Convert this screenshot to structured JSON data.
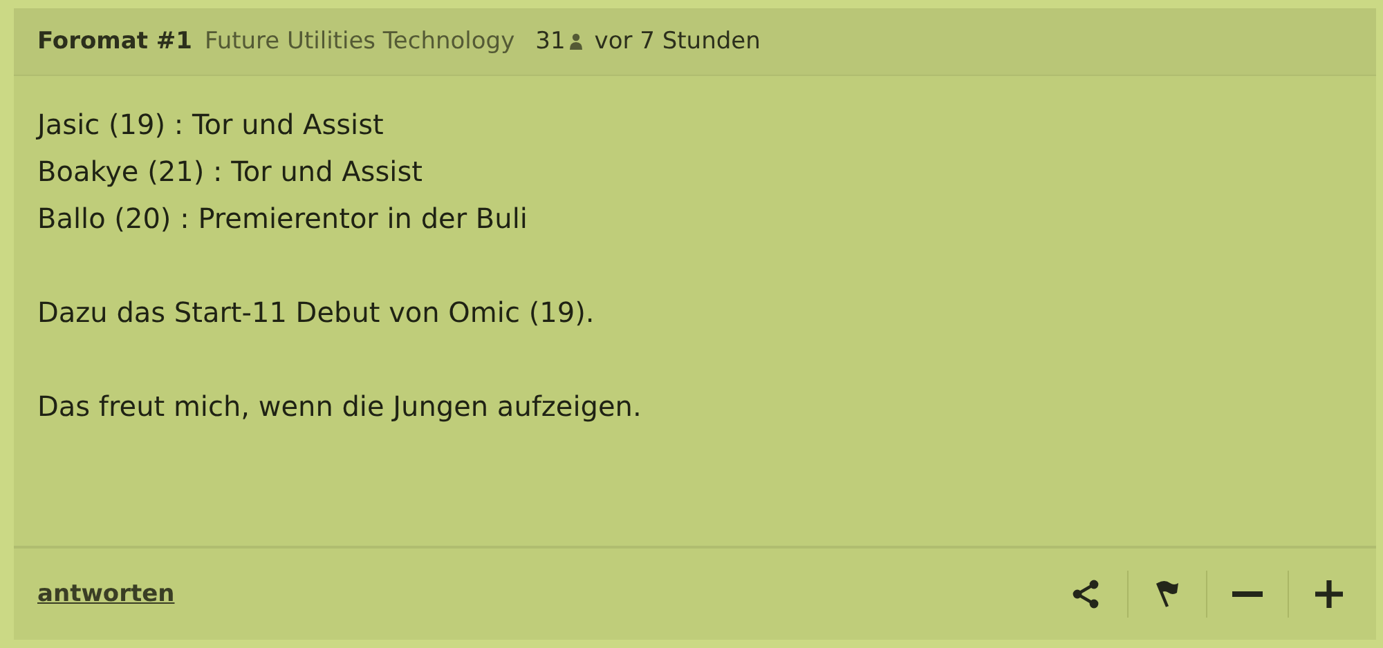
{
  "comment": {
    "author": "Foromat #1",
    "community": "Future Utilities Technology",
    "count": "31",
    "time": "vor 7 Stunden",
    "paragraphs": [
      [
        "Jasic (19) : Tor und Assist",
        "Boakye (21) : Tor und Assist",
        "Ballo (20) : Premierentor in der Buli"
      ],
      [
        "Dazu das Start-11 Debut von Omic (19)."
      ],
      [
        "Das freut mich, wenn die Jungen aufzeigen."
      ]
    ],
    "reply_link": "antworten"
  }
}
